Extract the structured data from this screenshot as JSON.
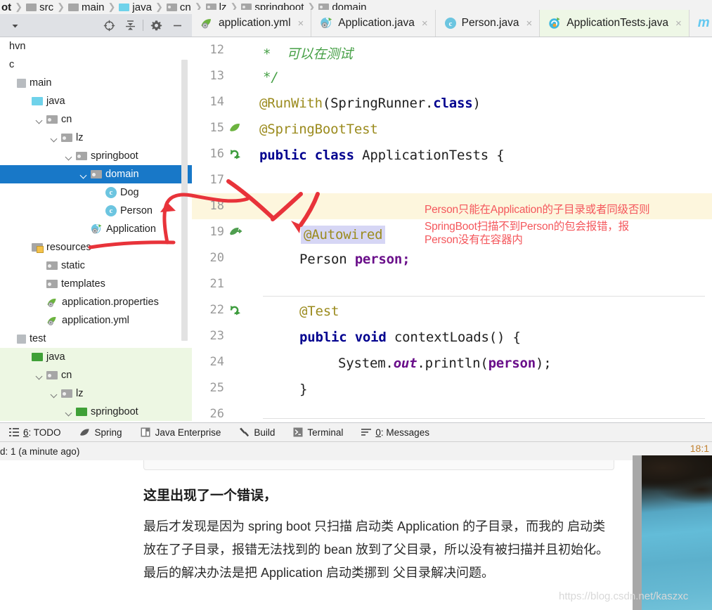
{
  "breadcrumb": [
    {
      "label": "ot",
      "icon": "none"
    },
    {
      "label": "src",
      "icon": "folder-grey"
    },
    {
      "label": "main",
      "icon": "folder-grey"
    },
    {
      "label": "java",
      "icon": "folder-cyan"
    },
    {
      "label": "cn",
      "icon": "folder-grey-dot"
    },
    {
      "label": "lz",
      "icon": "folder-grey-dot"
    },
    {
      "label": "springboot",
      "icon": "folder-grey-dot"
    },
    {
      "label": "domain",
      "icon": "folder-grey-dot"
    }
  ],
  "project_toolbar": {
    "buttons": [
      {
        "name": "dropdown-arrow",
        "icon": "chevron-down-icon"
      },
      {
        "name": "locate-file",
        "icon": "crosshair-target-icon"
      },
      {
        "name": "collapse-all",
        "icon": "collapse-all-icon"
      },
      {
        "name": "settings",
        "icon": "gear-icon"
      },
      {
        "name": "hide-panel",
        "icon": "minimize-icon"
      }
    ]
  },
  "tree": {
    "items": [
      {
        "label": "hvn",
        "indent": 0,
        "icon": "none",
        "arrow": false,
        "selected": false,
        "greenbg": false
      },
      {
        "label": "c",
        "indent": 0,
        "icon": "none",
        "arrow": false,
        "selected": false,
        "greenbg": false
      },
      {
        "label": "main",
        "indent": 0,
        "icon": "square-grey",
        "arrow": false,
        "selected": false,
        "greenbg": false
      },
      {
        "label": "java",
        "indent": 1,
        "icon": "folder-cyan",
        "arrow": false,
        "selected": false,
        "greenbg": false
      },
      {
        "label": "cn",
        "indent": 2,
        "icon": "folder-grey",
        "arrow": true,
        "selected": false,
        "greenbg": false
      },
      {
        "label": "lz",
        "indent": 3,
        "icon": "folder-grey",
        "arrow": true,
        "selected": false,
        "greenbg": false
      },
      {
        "label": "springboot",
        "indent": 4,
        "icon": "folder-grey",
        "arrow": true,
        "selected": false,
        "greenbg": false
      },
      {
        "label": "domain",
        "indent": 5,
        "icon": "folder-grey",
        "arrow": true,
        "selected": true,
        "greenbg": false
      },
      {
        "label": "Dog",
        "indent": 6,
        "icon": "class",
        "arrow": false,
        "selected": false,
        "greenbg": false
      },
      {
        "label": "Person",
        "indent": 6,
        "icon": "class",
        "arrow": false,
        "selected": false,
        "greenbg": false
      },
      {
        "label": "Application",
        "indent": 5,
        "icon": "spring-boot",
        "arrow": false,
        "selected": false,
        "greenbg": false
      },
      {
        "label": "resources",
        "indent": 1,
        "icon": "folder-res",
        "arrow": false,
        "selected": false,
        "greenbg": false
      },
      {
        "label": "static",
        "indent": 2,
        "icon": "folder-grey",
        "arrow": false,
        "selected": false,
        "greenbg": false
      },
      {
        "label": "templates",
        "indent": 2,
        "icon": "folder-grey",
        "arrow": false,
        "selected": false,
        "greenbg": false
      },
      {
        "label": "application.properties",
        "indent": 2,
        "icon": "yml",
        "arrow": false,
        "selected": false,
        "greenbg": false
      },
      {
        "label": "application.yml",
        "indent": 2,
        "icon": "yml",
        "arrow": false,
        "selected": false,
        "greenbg": false
      },
      {
        "label": "test",
        "indent": 0,
        "icon": "square-grey",
        "arrow": false,
        "selected": false,
        "greenbg": false
      },
      {
        "label": "java",
        "indent": 1,
        "icon": "folder-green",
        "arrow": false,
        "selected": false,
        "greenbg": true
      },
      {
        "label": "cn",
        "indent": 2,
        "icon": "folder-grey",
        "arrow": true,
        "selected": false,
        "greenbg": true
      },
      {
        "label": "lz",
        "indent": 3,
        "icon": "folder-grey",
        "arrow": true,
        "selected": false,
        "greenbg": true
      },
      {
        "label": "springboot",
        "indent": 4,
        "icon": "folder-green",
        "arrow": true,
        "selected": false,
        "greenbg": true
      }
    ]
  },
  "tabs": [
    {
      "label": "application.yml",
      "icon": "yml-icon",
      "active": false,
      "closable": true
    },
    {
      "label": "Application.java",
      "icon": "spring-boot-icon",
      "active": false,
      "closable": true
    },
    {
      "label": "Person.java",
      "icon": "java-class-icon",
      "active": false,
      "closable": true
    },
    {
      "label": "ApplicationTests.java",
      "icon": "junit-test-icon",
      "active": true,
      "closable": true
    },
    {
      "label": "m",
      "icon": "maven-icon",
      "active": false,
      "closable": false
    }
  ],
  "editor": {
    "lines": [
      {
        "num": "12",
        "gutter": "",
        "highlight": false
      },
      {
        "num": "13",
        "gutter": "",
        "highlight": false
      },
      {
        "num": "14",
        "gutter": "",
        "highlight": false
      },
      {
        "num": "15",
        "gutter": "leaf",
        "highlight": false
      },
      {
        "num": "16",
        "gutter": "rerun",
        "highlight": false
      },
      {
        "num": "17",
        "gutter": "",
        "highlight": false
      },
      {
        "num": "18",
        "gutter": "",
        "highlight": true
      },
      {
        "num": "19",
        "gutter": "bean",
        "highlight": false
      },
      {
        "num": "20",
        "gutter": "",
        "highlight": false
      },
      {
        "num": "21",
        "gutter": "",
        "highlight": false
      },
      {
        "num": "22",
        "gutter": "rerun",
        "highlight": false
      },
      {
        "num": "23",
        "gutter": "",
        "highlight": false
      },
      {
        "num": "24",
        "gutter": "",
        "highlight": false
      },
      {
        "num": "25",
        "gutter": "",
        "highlight": false
      },
      {
        "num": "26",
        "gutter": "",
        "highlight": false
      }
    ],
    "code": {
      "l12_star": "*",
      "l12_comment": "可以在测试",
      "l13": "*/",
      "l14_ann": "@RunWith",
      "l14_open": "(SpringRunner.",
      "l14_kw": "class",
      "l14_close": ")",
      "l15": "@SpringBootTest",
      "l16_kw1": "public",
      "l16_kw2": "class",
      "l16_name": "ApplicationTests {",
      "l18": "@Autowired",
      "l19_type": "Person ",
      "l19_field": "person",
      "l19_semi": ";",
      "l21": "@Test",
      "l22_kw1": "public",
      "l22_kw2": "void",
      "l22_sig": "contextLoads() {",
      "l23_a": "System.",
      "l23_out": "out",
      "l23_b": ".println(",
      "l23_arg": "person",
      "l23_c": ");",
      "l24": "}"
    }
  },
  "annotations": {
    "red_line1": "Person只能在Application的子目录或者同级否则",
    "red_line2": "SpringBoot扫描不到Person的包会报错，报",
    "red_line3": "Person没有在容器内",
    "accent_color": "#f4575c"
  },
  "tool_window_bar": {
    "items": [
      {
        "label_prefix": "6",
        "label": ": TODO",
        "icon": "todo-list-icon"
      },
      {
        "label_prefix": "",
        "label": "Spring",
        "icon": "spring-leaf-icon"
      },
      {
        "label_prefix": "",
        "label": "Java Enterprise",
        "icon": "java-ee-icon"
      },
      {
        "label_prefix": "",
        "label": "Build",
        "icon": "hammer-icon"
      },
      {
        "label_prefix": "",
        "label": "Terminal",
        "icon": "terminal-icon"
      },
      {
        "label_prefix": "0",
        "label": ": Messages",
        "icon": "messages-icon"
      }
    ]
  },
  "status_bar": {
    "left_text": "d: 1 (a minute ago)",
    "right_text": "18:1"
  },
  "document": {
    "heading": "这里出现了一个错误，",
    "paragraph": "最后才发现是因为 spring boot 只扫描 启动类 Application 的子目录，而我的 启动类 放在了子目录，报错无法找到的 bean 放到了父目录，所以没有被扫描并且初始化。最后的解决办法是把 Application 启动类挪到 父目录解决问题。",
    "watermark": "https://blog.csdn.net/kaszxc"
  }
}
